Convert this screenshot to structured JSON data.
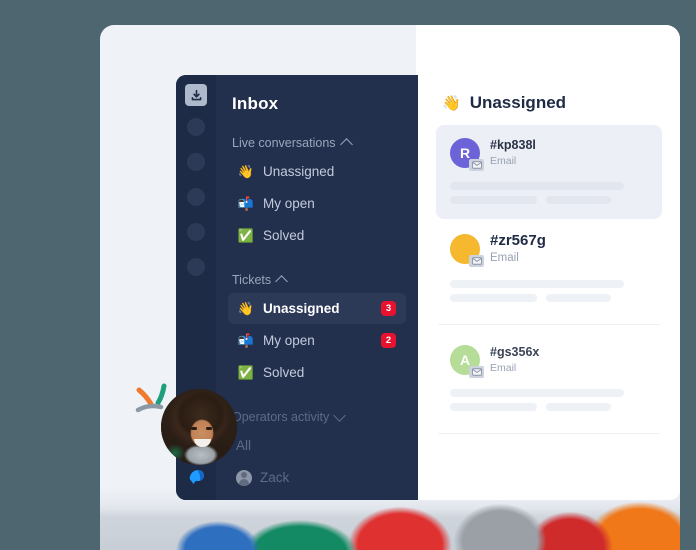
{
  "theme": {
    "page_background": "#4d6670",
    "panel_background": "#eff2f7",
    "sidebar_background": "#23304d",
    "sidebar_rail_background": "#1e2b47",
    "sidebar_active_background": "#2c3a58",
    "badge_color": "#e8122e",
    "list_background": "#ffffff",
    "selected_card_background": "#eceff5"
  },
  "sidebar": {
    "title": "Inbox",
    "rail": {
      "inbox_icon": "inbox-download-icon",
      "dots": [
        "rail-dot-1",
        "rail-dot-2",
        "rail-dot-3",
        "rail-dot-4",
        "rail-dot-5"
      ],
      "logo": "crisp-logo-icon"
    },
    "sections": [
      {
        "label": "Live conversations",
        "chevron": "chevron-up-icon",
        "expanded": true,
        "items": [
          {
            "emoji": "👋",
            "emoji_name": "waving-hand-icon",
            "label": "Unassigned",
            "badge": "",
            "active": false
          },
          {
            "emoji": "📬",
            "emoji_name": "mailbox-icon",
            "label": "My open",
            "badge": "",
            "active": false
          },
          {
            "emoji": "✅",
            "emoji_name": "check-mark-icon",
            "label": "Solved",
            "badge": "",
            "active": false
          }
        ]
      },
      {
        "label": "Tickets",
        "chevron": "chevron-up-icon",
        "expanded": true,
        "items": [
          {
            "emoji": "👋",
            "emoji_name": "waving-hand-icon",
            "label": "Unassigned",
            "badge": "3",
            "active": true
          },
          {
            "emoji": "📬",
            "emoji_name": "mailbox-icon",
            "label": "My open",
            "badge": "2",
            "active": false
          },
          {
            "emoji": "✅",
            "emoji_name": "check-mark-icon",
            "label": "Solved",
            "badge": "",
            "active": false
          }
        ]
      },
      {
        "label": "Operators activity",
        "chevron": "chevron-down-icon",
        "expanded": false,
        "items": [
          {
            "emoji": "",
            "emoji_name": "",
            "label": "All",
            "badge": "",
            "active": false,
            "dim": true
          },
          {
            "emoji": "",
            "emoji_name": "operator-avatar",
            "label": "Zack",
            "badge": "",
            "active": false,
            "dim": true,
            "avatar": true
          }
        ]
      }
    ]
  },
  "list": {
    "header": {
      "emoji": "👋",
      "emoji_name": "waving-hand-icon",
      "title": "Unassigned"
    },
    "conversations": [
      {
        "id": "#kp838l",
        "channel": "Email",
        "avatar_letter": "R",
        "avatar_color": "#6c63d8",
        "channel_icon": "email-icon",
        "selected": true
      },
      {
        "id": "#zr567g",
        "channel": "Email",
        "avatar_letter": "",
        "avatar_color": "#f5b82e",
        "channel_icon": "email-icon",
        "selected": false
      },
      {
        "id": "#gs356x",
        "channel": "Email",
        "avatar_letter": "A",
        "avatar_color": "#b6dd98",
        "channel_icon": "email-icon",
        "selected": false
      }
    ]
  },
  "decorations": {
    "operator_photo": "operator-portrait",
    "strokes": [
      "orange-stroke",
      "teal-stroke",
      "gray-stroke"
    ],
    "bottom_photo": "colorful-knit-photo"
  }
}
